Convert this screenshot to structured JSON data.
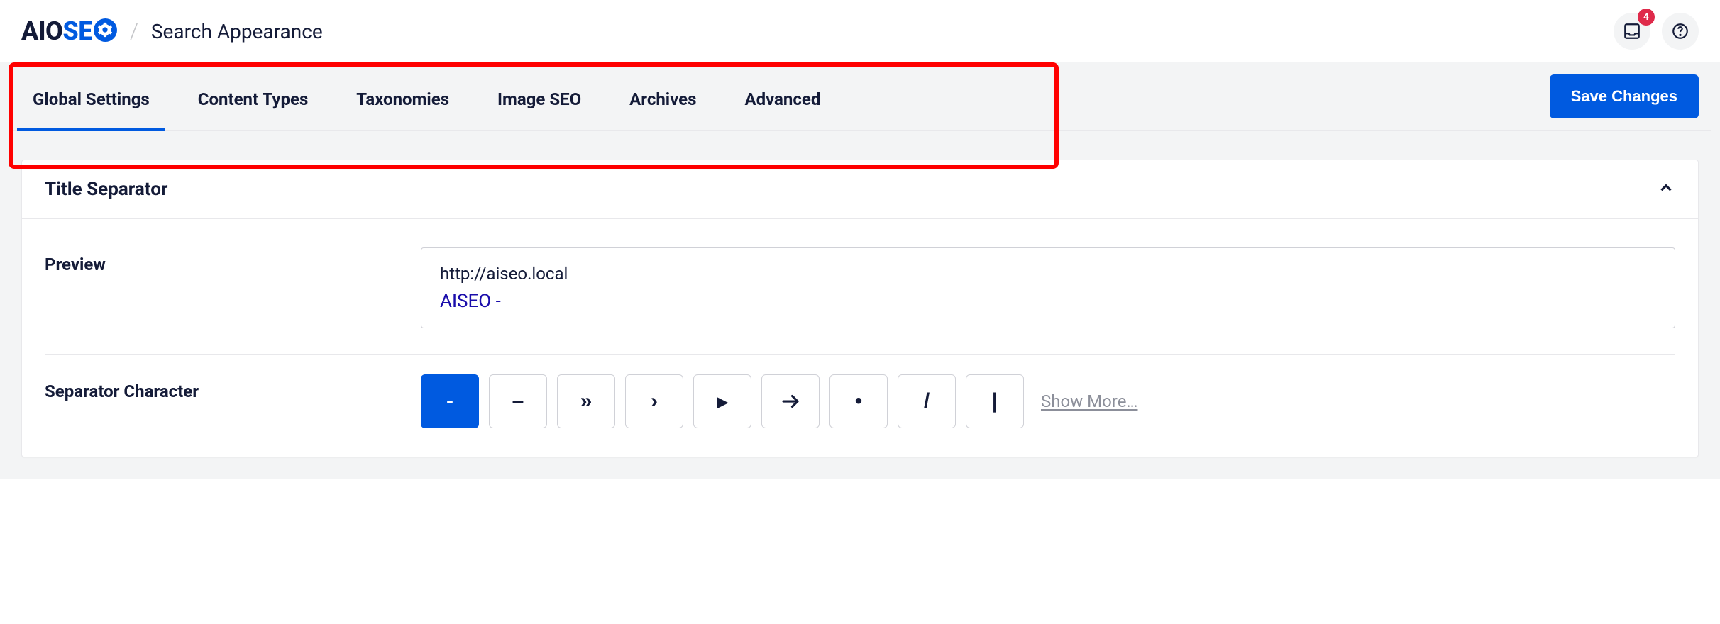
{
  "header": {
    "logo_aio": "AIO",
    "logo_se": "SE",
    "page_title": "Search Appearance",
    "notification_count": "4"
  },
  "tabs": [
    {
      "label": "Global Settings",
      "active": true
    },
    {
      "label": "Content Types",
      "active": false
    },
    {
      "label": "Taxonomies",
      "active": false
    },
    {
      "label": "Image SEO",
      "active": false
    },
    {
      "label": "Archives",
      "active": false
    },
    {
      "label": "Advanced",
      "active": false
    }
  ],
  "actions": {
    "save": "Save Changes"
  },
  "card": {
    "title": "Title Separator",
    "preview_label": "Preview",
    "preview_url": "http://aiseo.local",
    "preview_title": "AISEO -",
    "separator_label": "Separator Character",
    "separators": [
      "-",
      "–",
      "»",
      "›",
      "▸",
      "→",
      "•",
      "/",
      "|"
    ],
    "separator_active_index": 0,
    "show_more": "Show More…"
  }
}
